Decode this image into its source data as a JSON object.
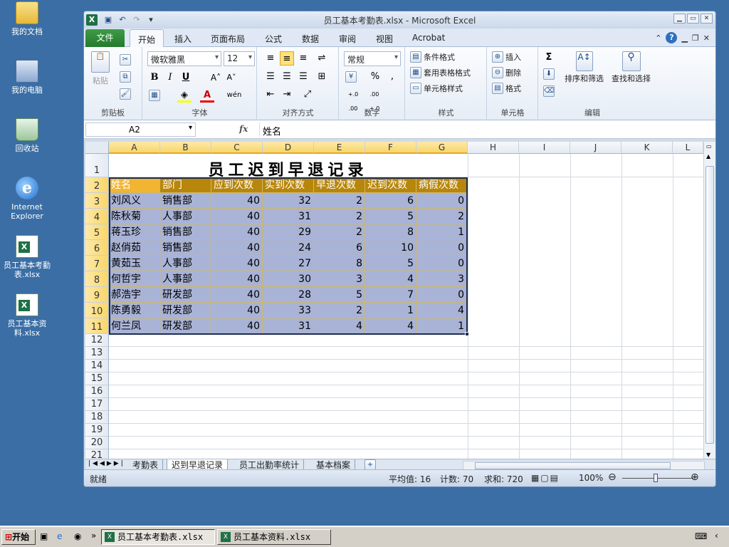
{
  "desktop": {
    "icons": [
      {
        "name": "my-documents-icon",
        "label": "我的文档"
      },
      {
        "name": "my-computer-icon",
        "label": "我的电脑"
      },
      {
        "name": "recycle-bin-icon",
        "label": "回收站"
      },
      {
        "name": "internet-explorer-icon",
        "label": "Internet Explorer"
      },
      {
        "name": "excel-file-icon",
        "label": "员工基本考勤表.xlsx"
      },
      {
        "name": "excel-file-icon",
        "label": "员工基本资料.xlsx"
      }
    ]
  },
  "window": {
    "title": "员工基本考勤表.xlsx - Microsoft Excel",
    "app_icon": "X"
  },
  "ribbon_tabs": {
    "file": "文件",
    "items": [
      "开始",
      "插入",
      "页面布局",
      "公式",
      "数据",
      "审阅",
      "视图",
      "Acrobat"
    ]
  },
  "ribbon": {
    "clipboard": {
      "paste": "粘贴",
      "label": "剪贴板"
    },
    "font": {
      "name": "微软雅黑",
      "size": "12",
      "label": "字体",
      "bold": "B",
      "italic": "I",
      "underline": "U",
      "grow": "A˄",
      "shrink": "A˅",
      "phonetic": "wén"
    },
    "align": {
      "label": "对齐方式"
    },
    "number": {
      "format": "常规",
      "label": "数字",
      "percent": "%",
      "comma": ",",
      "inc": "+.0 .00",
      "dec": ".00 +.0"
    },
    "styles": {
      "cond": "条件格式",
      "table": "套用表格格式",
      "cell": "单元格样式",
      "label": "样式"
    },
    "cells": {
      "insert": "插入",
      "delete": "删除",
      "format": "格式",
      "label": "单元格"
    },
    "editing": {
      "sort": "排序和筛选",
      "find": "查找和选择",
      "label": "编辑",
      "sigma": "Σ"
    }
  },
  "formula_bar": {
    "name_box": "A2",
    "fx": "fx",
    "value": "姓名"
  },
  "sheet": {
    "columns": [
      "A",
      "B",
      "C",
      "D",
      "E",
      "F",
      "G",
      "H",
      "I",
      "J",
      "K",
      "L"
    ],
    "rows": [
      "1",
      "2",
      "3",
      "4",
      "5",
      "6",
      "7",
      "8",
      "9",
      "10",
      "11",
      "12",
      "13",
      "14",
      "15",
      "16",
      "17",
      "18",
      "19",
      "20",
      "21"
    ],
    "title": "员工迟到早退记录",
    "headers": [
      "姓名",
      "部门",
      "应到次数",
      "实到次数",
      "早退次数",
      "迟到次数",
      "病假次数"
    ],
    "data": [
      [
        "刘风义",
        "销售部",
        "40",
        "32",
        "2",
        "6",
        "0"
      ],
      [
        "陈秋菊",
        "人事部",
        "40",
        "31",
        "2",
        "5",
        "2"
      ],
      [
        "蒋玉珍",
        "销售部",
        "40",
        "29",
        "2",
        "8",
        "1"
      ],
      [
        "赵俏茹",
        "销售部",
        "40",
        "24",
        "6",
        "10",
        "0"
      ],
      [
        "黄茹玉",
        "人事部",
        "40",
        "27",
        "8",
        "5",
        "0"
      ],
      [
        "何哲宇",
        "人事部",
        "40",
        "30",
        "3",
        "4",
        "3"
      ],
      [
        "郝浩宇",
        "研发部",
        "40",
        "28",
        "5",
        "7",
        "0"
      ],
      [
        "陈勇毅",
        "研发部",
        "40",
        "33",
        "2",
        "1",
        "4"
      ],
      [
        "何兰凤",
        "研发部",
        "40",
        "31",
        "4",
        "4",
        "1"
      ]
    ],
    "colors": {
      "header_bg": "#b8860b",
      "active_header_bg": "#f2b531",
      "body_bg": "#a9b3d6"
    }
  },
  "sheet_tabs": [
    "考勤表",
    "迟到早退记录",
    "员工出勤率统计",
    "基本档案"
  ],
  "status": {
    "ready": "就绪",
    "average": "平均值: 16",
    "count": "计数: 70",
    "sum": "求和: 720",
    "zoom": "100%"
  },
  "taskbar": {
    "start": "开始",
    "tasks": [
      "员工基本考勤表.xlsx",
      "员工基本资料.xlsx"
    ]
  }
}
